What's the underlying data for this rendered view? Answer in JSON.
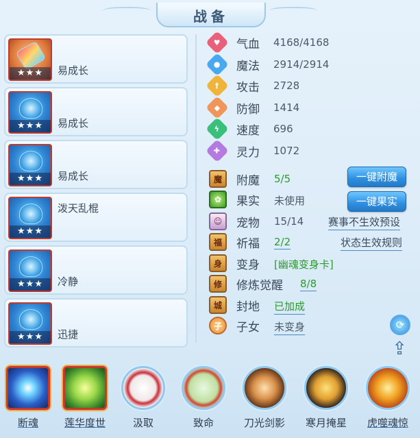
{
  "header": {
    "title": "战备"
  },
  "colors": {
    "accent": "#2f8fe0",
    "green_value": "#2c9a2c",
    "frame_red": "#c03b2e"
  },
  "equipment": [
    {
      "name": "易成长",
      "stars": "★★★",
      "icon": "popsicle-icon"
    },
    {
      "name": "易成长",
      "stars": "★★★",
      "icon": "blue-helmet-icon"
    },
    {
      "name": "易成长",
      "stars": "★★★",
      "icon": "blue-armor-icon"
    },
    {
      "name": "泼天乱棍",
      "stars": "★★★",
      "icon": "blue-weapon-icon"
    },
    {
      "name": "冷静",
      "stars": "★★★",
      "icon": "blue-boots-icon"
    },
    {
      "name": "迅捷",
      "stars": "★★★",
      "icon": "blue-crown-icon"
    }
  ],
  "stats": [
    {
      "name": "气血",
      "value": "4168/4168",
      "icon": "heart-icon",
      "color": "#e8607a"
    },
    {
      "name": "魔法",
      "value": "2914/2914",
      "icon": "mana-icon",
      "color": "#4aa8f0"
    },
    {
      "name": "攻击",
      "value": "2728",
      "icon": "sword-icon",
      "color": "#f0b43a"
    },
    {
      "name": "防御",
      "value": "1414",
      "icon": "shield-icon",
      "color": "#f0965a"
    },
    {
      "name": "速度",
      "value": "696",
      "icon": "lightning-icon",
      "color": "#3ac07a"
    },
    {
      "name": "灵力",
      "value": "1072",
      "icon": "spirit-icon",
      "color": "#b47ae0"
    }
  ],
  "attributes": {
    "enchant": {
      "name": "附魔",
      "value": "5/5"
    },
    "fruit": {
      "name": "果实",
      "value": "未使用"
    },
    "pet": {
      "name": "宠物",
      "value": "15/14"
    },
    "blessing": {
      "name": "祈福",
      "value": "2/2"
    },
    "transform": {
      "name": "变身",
      "value": "[幽魂变身卡]"
    },
    "cultivation": {
      "name": "修炼觉醒",
      "value": "8/8"
    },
    "territory": {
      "name": "封地",
      "value": "已加成"
    },
    "children": {
      "name": "子女",
      "value": "未变身"
    }
  },
  "buttons": {
    "enchant": "一键附魔",
    "fruit": "一键果实"
  },
  "links": {
    "event_preset": "赛事不生效预设",
    "status_rules": "状态生效规则"
  },
  "skills": [
    {
      "name": "断魂",
      "icon": "blue-orb-icon"
    },
    {
      "name": "莲华度世",
      "icon": "lotus-hand-icon"
    },
    {
      "name": "汲取",
      "icon": "drain-icon"
    },
    {
      "name": "致命",
      "icon": "vine-icon"
    },
    {
      "name": "刀光剑影",
      "icon": "blade-icon"
    },
    {
      "name": "寒月掩星",
      "icon": "moon-warrior-icon"
    },
    {
      "name": "虎噬魂惊",
      "icon": "tiger-fire-icon"
    }
  ]
}
